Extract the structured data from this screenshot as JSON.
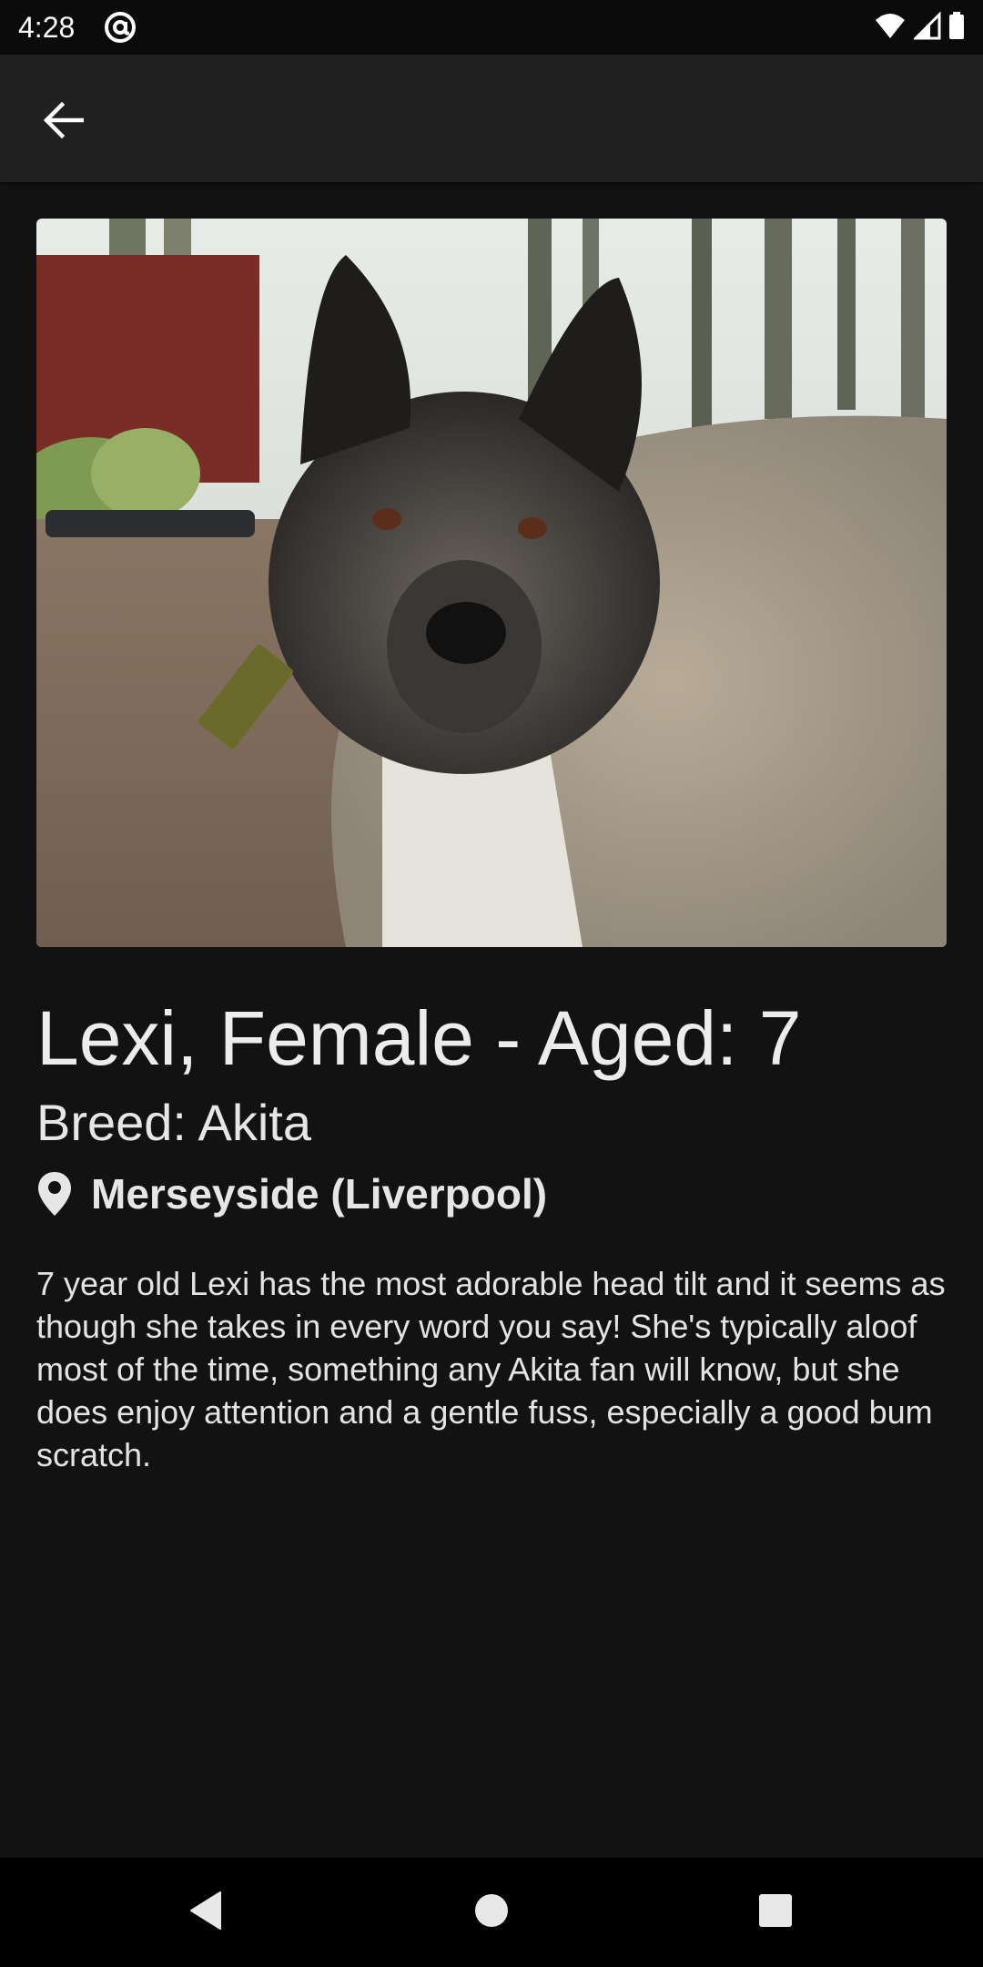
{
  "status_bar": {
    "time": "4:28"
  },
  "icons": {
    "status_app": "at-sign-icon",
    "wifi": "wifi-icon",
    "signal": "cell-signal-icon",
    "battery": "battery-icon",
    "back": "arrow-left-icon",
    "location": "map-pin-icon",
    "nav_back": "triangle-back-icon",
    "nav_home": "circle-home-icon",
    "nav_recents": "square-recents-icon"
  },
  "dog": {
    "title": "Lexi, Female - Aged: 7",
    "breed": "Breed: Akita",
    "location": "Merseyside (Liverpool)",
    "description": "7 year old Lexi has the most adorable head tilt and it seems as though she takes in every word you say! She's typically aloof most of the time, something any Akita fan will know, but she does enjoy attention and a gentle fuss, especially a good bum scratch."
  },
  "colors": {
    "background": "#121212",
    "app_bar": "#202020",
    "status_bar": "#0b0b0b",
    "nav_bar": "#000000",
    "text": "#ececec"
  }
}
